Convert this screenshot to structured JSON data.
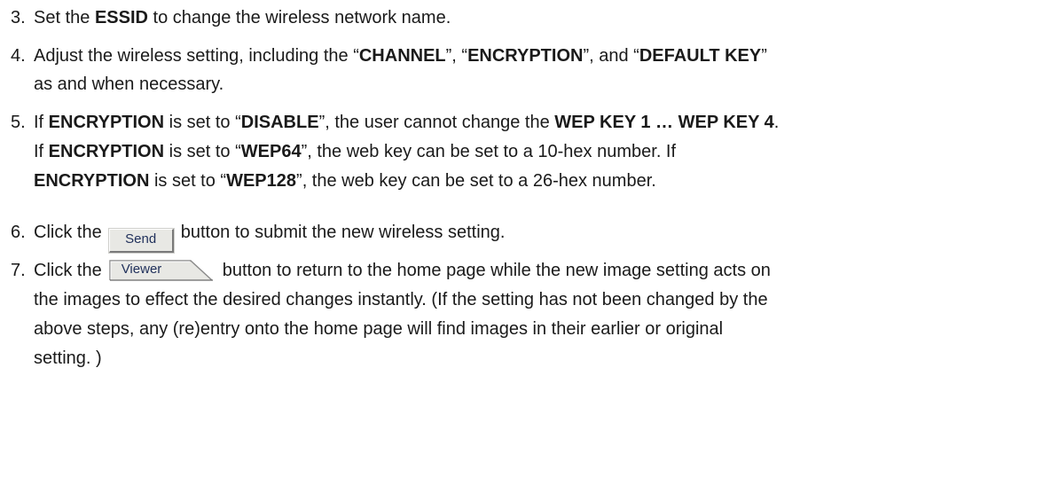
{
  "steps": [
    {
      "number": "3.",
      "lines": [
        {
          "parts": [
            "Set the ",
            "ESSID",
            " to change the wireless network name."
          ]
        }
      ]
    },
    {
      "number": "4.",
      "lines": [
        {
          "parts": [
            "Adjust the wireless setting, including the “",
            "CHANNEL",
            "”, “",
            "ENCRYPTION",
            "”, and “",
            "DEFAULT KEY",
            "”"
          ]
        },
        {
          "parts": [
            "as and when necessary."
          ]
        }
      ]
    },
    {
      "number": "5.",
      "lines": [
        {
          "parts": [
            "If ",
            "ENCRYPTION",
            " is set to “",
            "DISABLE",
            "”, the user cannot change the ",
            "WEP KEY 1 … WEP KEY 4",
            "."
          ]
        },
        {
          "parts": [
            "If ",
            "ENCRYPTION",
            " is set to “",
            "WEP64",
            "”, the web key can be set to a 10-hex number. If"
          ]
        },
        {
          "parts": [
            "ENCRYPTION",
            " is set to “",
            "WEP128",
            "”, the web key can be set to a 26-hex number."
          ]
        }
      ]
    },
    {
      "number": "6.",
      "lines": [
        {
          "parts": [
            "Click the",
            "button to submit the new wireless setting."
          ]
        }
      ]
    },
    {
      "number": "7.",
      "lines": [
        {
          "parts": [
            "Click the",
            "button to return to the home page while the new image setting acts on"
          ]
        },
        {
          "parts": [
            "the images to effect the desired changes instantly. (If the setting has not been changed by the"
          ]
        },
        {
          "parts": [
            "above steps, any (re)entry onto the home page will find images in their earlier or original"
          ]
        },
        {
          "parts": [
            "setting. )"
          ]
        }
      ]
    }
  ],
  "buttons": {
    "send_label": "Send",
    "viewer_label": "Viewer"
  },
  "colors": {
    "text": "#1a1a1a",
    "button_face": "#e8e8e4",
    "button_text": "#1f2f5a"
  }
}
